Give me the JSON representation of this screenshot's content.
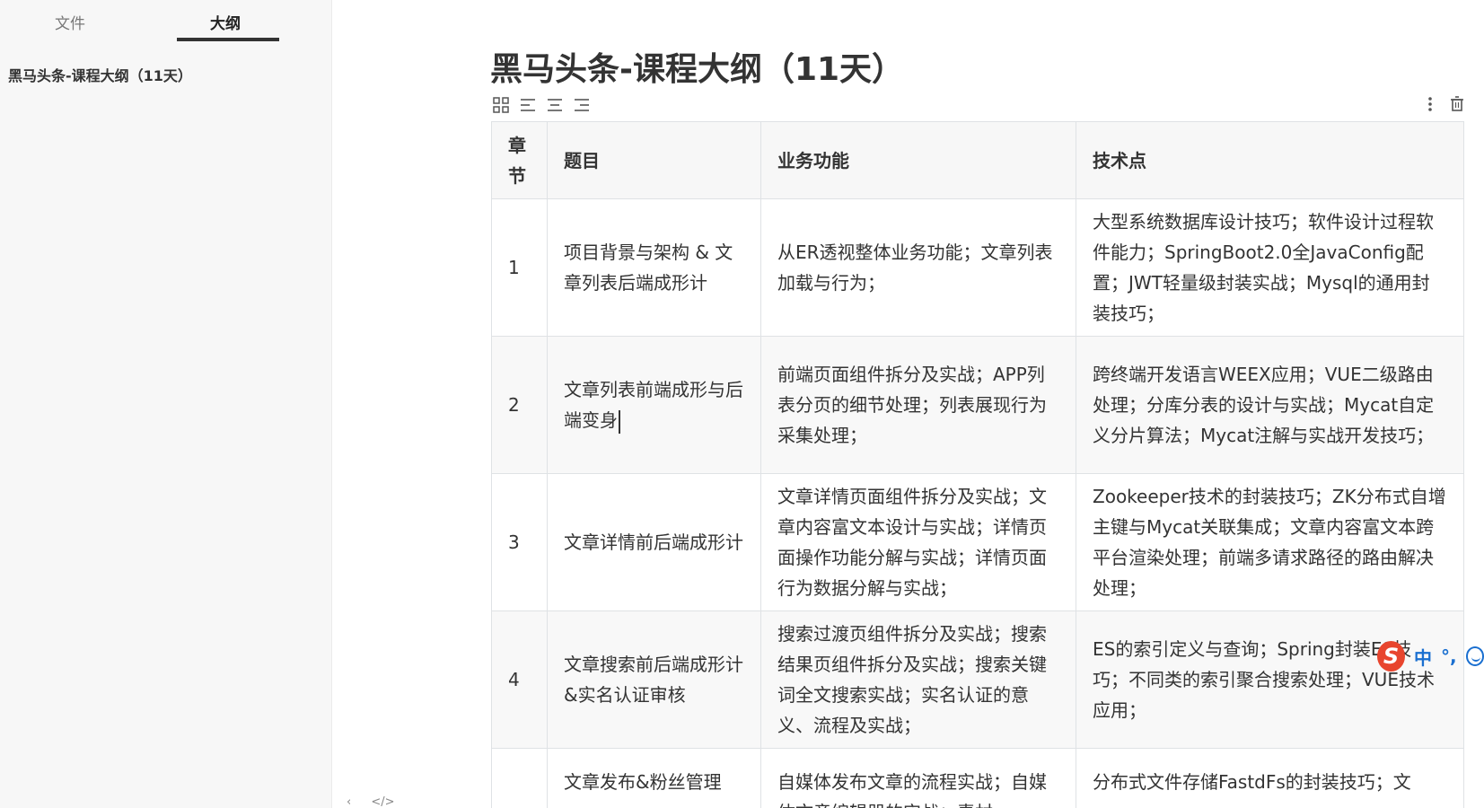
{
  "sidebar": {
    "tabs": [
      {
        "label": "文件",
        "active": false
      },
      {
        "label": "大纲",
        "active": true
      }
    ],
    "outline_items": [
      "黑马头条-课程大纲（11天）"
    ]
  },
  "footer": {
    "icons": [
      "chevron-left-icon",
      "source-code-icon"
    ],
    "glyphs": [
      "‹",
      "</>"
    ]
  },
  "document": {
    "title": "黑马头条-课程大纲（11天）"
  },
  "table_toolbar": {
    "icons": [
      "table-grid-icon",
      "align-left-icon",
      "align-center-icon",
      "align-right-icon"
    ],
    "right_icons": [
      "more-vertical-icon",
      "delete-icon"
    ]
  },
  "table": {
    "headers": [
      "章节",
      "题目",
      "业务功能",
      "技术点"
    ],
    "rows": [
      {
        "chapter": "1",
        "topic": "项目背景与架构  & 文章列表后端成形计",
        "business": "从ER透视整体业务功能；文章列表加载与行为；",
        "tech": "大型系统数据库设计技巧；软件设计过程软件能力；SpringBoot2.0全JavaConfig配置；JWT轻量级封装实战；Mysql的通用封装技巧；"
      },
      {
        "chapter": "2",
        "topic": "文章列表前端成形与后端变身",
        "business": "前端页面组件拆分及实战；APP列表分页的细节处理；列表展现行为采集处理；",
        "tech": "跨终端开发语言WEEX应用；VUE二级路由处理；分库分表的设计与实战；Mycat自定义分片算法；Mycat注解与实战开发技巧；"
      },
      {
        "chapter": "3",
        "topic": "文章详情前后端成形计",
        "business": "文章详情页面组件拆分及实战；文章内容富文本设计与实战；详情页面操作功能分解与实战；详情页面行为数据分解与实战；",
        "tech": "Zookeeper技术的封装技巧；ZK分布式自增主键与Mycat关联集成；文章内容富文本跨平台渲染处理；前端多请求路径的路由解决处理；"
      },
      {
        "chapter": "4",
        "topic": "文章搜索前后端成形计&实名认证审核",
        "business": "搜索过渡页组件拆分及实战；搜索结果页组件拆分及实战；搜索关键词全文搜索实战；实名认证的意义、流程及实战；",
        "tech": "ES的索引定义与查询；Spring封装ES技巧；不同类的索引聚合搜索处理；VUE技术应用；"
      },
      {
        "chapter": "",
        "topic": "文章发布&粉丝管理",
        "business": "自媒体发布文章的流程实战；自媒体文章编辑器的实战；素材",
        "tech": "分布式文件存储FastdFs的封装技巧；文"
      }
    ]
  },
  "ime": {
    "logo": "S",
    "mode": "中",
    "punct": "°,"
  }
}
